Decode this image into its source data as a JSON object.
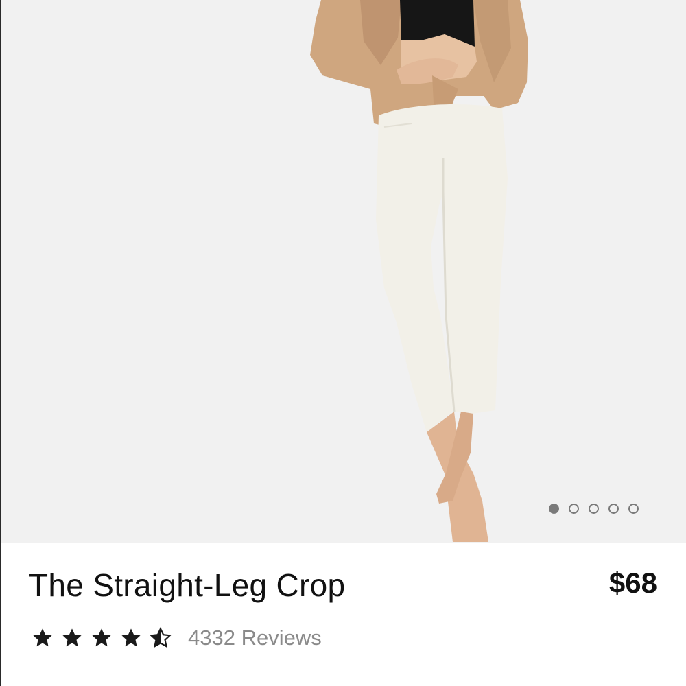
{
  "product": {
    "name": "The Straight-Leg Crop",
    "price": "$68",
    "reviews_label": "4332 Reviews",
    "rating": 4.5,
    "rating_max": 5
  },
  "carousel": {
    "count": 5,
    "active": 0
  },
  "icons": [
    "star-icon",
    "half-star-icon"
  ],
  "colors": {
    "text": "#111111",
    "muted": "#8a8a8a",
    "image_bg": "#f1f1f1",
    "dot": "#7a7a7a"
  }
}
